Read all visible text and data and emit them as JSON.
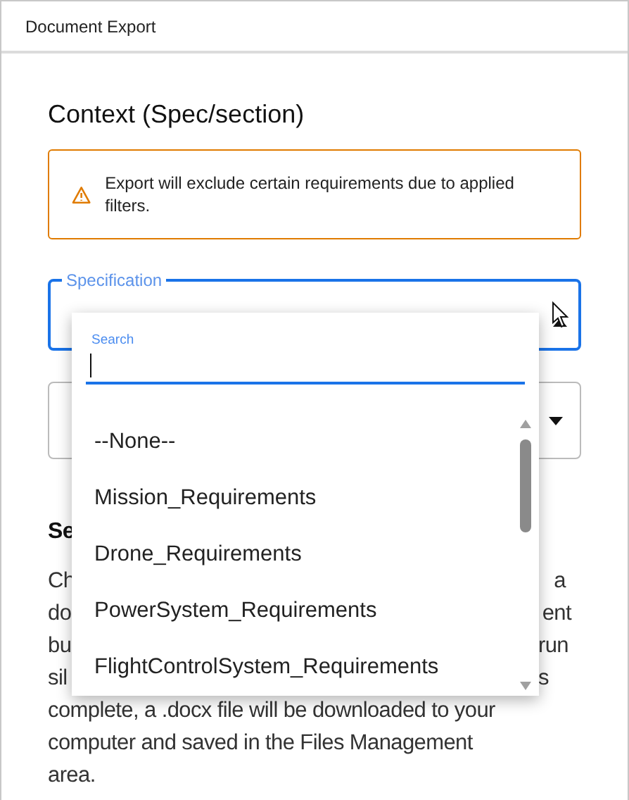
{
  "window": {
    "title": "Document Export"
  },
  "context": {
    "heading": "Context (Spec/section)",
    "warning": "Export will exclude certain requirements due to applied filters.",
    "specification_field": {
      "label": "Specification",
      "expanded": true
    }
  },
  "section": {
    "heading": "Se",
    "lines": [
      {
        "kind": "cut",
        "start": "Ch",
        "end": "a"
      },
      {
        "kind": "cut",
        "start": "do",
        "end": "ent"
      },
      {
        "kind": "cut",
        "start": "bu",
        "end": "run"
      },
      {
        "kind": "cut",
        "start": "sil",
        "end": "s"
      },
      {
        "kind": "full",
        "text": "complete, a .docx file will be downloaded to your"
      },
      {
        "kind": "full",
        "text": "computer and saved in the Files Management"
      },
      {
        "kind": "full",
        "text": "area."
      }
    ]
  },
  "dropdown": {
    "search": {
      "label": "Search"
    },
    "options": [
      {
        "label": "--None--",
        "selected": false
      },
      {
        "label": "Mission_Requirements",
        "selected": false
      },
      {
        "label": "Drone_Requirements",
        "selected": false
      },
      {
        "label": "PowerSystem_Requirements",
        "selected": false
      },
      {
        "label": "FlightControlSystem_Requirements",
        "selected": false
      }
    ]
  }
}
